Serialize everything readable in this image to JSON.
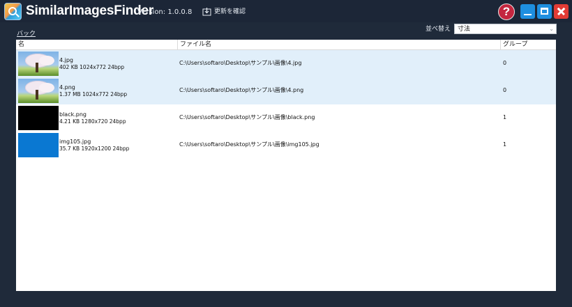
{
  "app": {
    "title": "SimilarImagesFinder",
    "version": "Version: 1.0.0.8",
    "update_check_label": "更新を確認",
    "help_glyph": "?"
  },
  "icons": {
    "app_logo": "magnifier-logo-icon",
    "update": "download-icon",
    "help": "help-icon",
    "minimize": "minimize-icon",
    "maximize": "maximize-icon",
    "close": "close-icon"
  },
  "toolbar": {
    "back_label": "バック",
    "sort_label": "並べ替え",
    "sort_value": "寸法",
    "sort_caret": "⌄"
  },
  "table": {
    "columns": [
      "名",
      "ファイル名",
      "グループ"
    ],
    "rows": [
      {
        "name": "4.jpg",
        "size": "402 KB",
        "dimensions": "1024x772",
        "bpp": "24bpp",
        "meta": "402 KB  1024x772  24bpp",
        "path": "C:\\Users\\softaro\\Desktop\\サンプル\\画像\\4.jpg",
        "group": "0",
        "selected": true,
        "thumbnail": "tree"
      },
      {
        "name": "4.png",
        "size": "1.37 MB",
        "dimensions": "1024x772",
        "bpp": "24bpp",
        "meta": "1.37 MB  1024x772  24bpp",
        "path": "C:\\Users\\softaro\\Desktop\\サンプル\\画像\\4.png",
        "group": "0",
        "selected": true,
        "thumbnail": "tree"
      },
      {
        "name": "black.png",
        "size": "4.21 KB",
        "dimensions": "1280x720",
        "bpp": "24bpp",
        "meta": "4.21 KB  1280x720  24bpp",
        "path": "C:\\Users\\softaro\\Desktop\\サンプル\\画像\\black.png",
        "group": "1",
        "selected": false,
        "thumbnail": "black"
      },
      {
        "name": "img105.jpg",
        "size": "35.7 KB",
        "dimensions": "1920x1200",
        "bpp": "24bpp",
        "meta": "35.7 KB  1920x1200  24bpp",
        "path": "C:\\Users\\softaro\\Desktop\\サンプル\\画像\\img105.jpg",
        "group": "1",
        "selected": false,
        "thumbnail": "blue"
      }
    ]
  },
  "colors": {
    "background": "#1f2a3a",
    "selected_row": "#e1effa",
    "accent_blue": "#1e8fe0",
    "close_red": "#e23b35",
    "help_red": "#c4263f"
  }
}
